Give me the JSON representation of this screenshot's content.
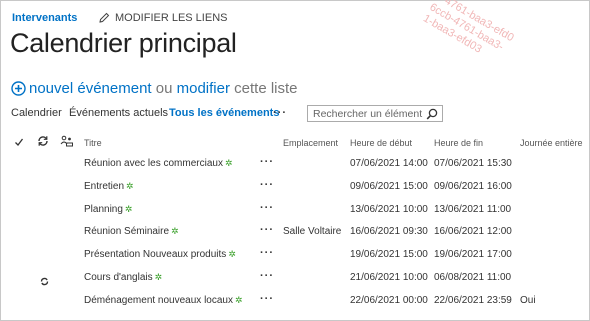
{
  "breadcrumb": {
    "label": "Intervenants"
  },
  "edit_links": {
    "label": "MODIFIER LES LIENS"
  },
  "page_title": "Calendrier principal",
  "new_event": {
    "new_label": "nouvel événement",
    "or_label": "ou",
    "edit_label": "modifier",
    "list_label": "cette liste"
  },
  "views": {
    "calendar": "Calendrier",
    "current": "Événements actuels",
    "all": "Tous les événements",
    "more": "···"
  },
  "search": {
    "placeholder": "Rechercher un élément"
  },
  "columns": {
    "title": "Titre",
    "location": "Emplacement",
    "start": "Heure de début",
    "end": "Heure de fin",
    "all_day": "Journée entière"
  },
  "rows": [
    {
      "title": "Réunion avec les commerciaux",
      "location": "",
      "start": "07/06/2021 14:00",
      "end": "07/06/2021 15:30",
      "all_day": "",
      "recurring": false
    },
    {
      "title": "Entretien",
      "location": "",
      "start": "09/06/2021 15:00",
      "end": "09/06/2021 16:00",
      "all_day": "",
      "recurring": false
    },
    {
      "title": "Planning",
      "location": "",
      "start": "13/06/2021 10:00",
      "end": "13/06/2021 11:00",
      "all_day": "",
      "recurring": false
    },
    {
      "title": "Réunion Séminaire",
      "location": "Salle Voltaire",
      "start": "16/06/2021 09:30",
      "end": "16/06/2021 12:00",
      "all_day": "",
      "recurring": false
    },
    {
      "title": "Présentation Nouveaux produits",
      "location": "",
      "start": "19/06/2021 15:00",
      "end": "19/06/2021 17:00",
      "all_day": "",
      "recurring": false
    },
    {
      "title": "Cours d'anglais",
      "location": "",
      "start": "21/06/2021 10:00",
      "end": "06/08/2021 11:00",
      "all_day": "",
      "recurring": true
    },
    {
      "title": "Déménagement nouveaux locaux",
      "location": "",
      "start": "22/06/2021 00:00",
      "end": "22/06/2021 23:59",
      "all_day": "Oui",
      "recurring": false
    }
  ],
  "row_dots": "···",
  "new_marker": "✲",
  "watermark": {
    "lines": [
      "b-4761-baa3-efd0",
      "6ccb-4761-baa3-",
      "1-baa3-efd03"
    ]
  },
  "colors": {
    "accent": "#0072c6",
    "new_marker": "#3aa02a",
    "watermark": "#f1b7b7"
  }
}
